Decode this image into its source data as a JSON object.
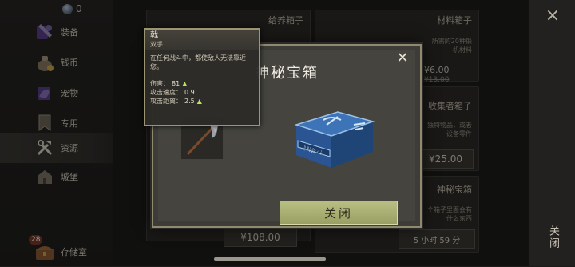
{
  "header": {
    "currency_value": "0"
  },
  "sidebar": {
    "items": [
      {
        "label": "装备",
        "icon": "armor-icon"
      },
      {
        "label": "钱币",
        "icon": "coin-bag-icon"
      },
      {
        "label": "宠物",
        "icon": "pet-icon"
      },
      {
        "label": "专用",
        "icon": "banner-icon"
      },
      {
        "label": "资源",
        "icon": "tools-icon",
        "active": true
      },
      {
        "label": "城堡",
        "icon": "castle-icon"
      }
    ],
    "storage": {
      "label": "存储室",
      "badge": "28"
    }
  },
  "shop": {
    "panels": [
      {
        "title": "给养箱子"
      },
      {
        "title": "材料箱子",
        "desc_lines": [
          "所需的20种锻",
          "机材料"
        ],
        "price": "¥6.00",
        "old_price": "¥13.00"
      },
      {
        "title": "收集者箱子",
        "desc_lines": [
          "独特物品，或者",
          "设备零件"
        ],
        "price": "¥25.00"
      },
      {
        "title": "神秘宝箱",
        "desc_lines": [
          "个箱子里面会有",
          "什么东西"
        ],
        "timer": "5 小时 59 分"
      }
    ],
    "bottom_price": "¥108.00"
  },
  "right_strip": {
    "close_label": "关闭"
  },
  "modal": {
    "title": "神秘宝箱",
    "close_button": "关闭"
  },
  "tooltip": {
    "name": "戟",
    "type": "双手",
    "description": "在任何战斗中，都使敌人无法靠近您。",
    "stats": [
      {
        "label": "伤害：",
        "value": "81"
      },
      {
        "label": "攻击速度：",
        "value": "0.9"
      },
      {
        "label": "攻击距离：",
        "value": "2.5"
      }
    ]
  },
  "colors": {
    "accent_button": "#a8ad70",
    "stat_up": "#b9e06a",
    "chest_blue": "#2d5fa0"
  }
}
